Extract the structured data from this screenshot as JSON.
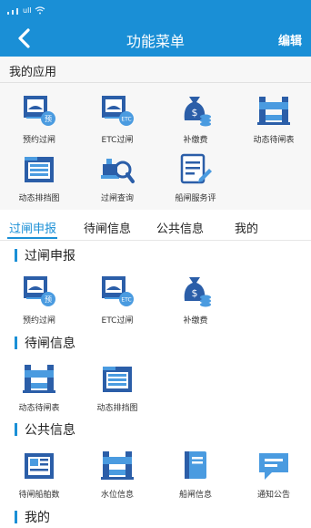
{
  "status": {
    "carrier": "ull",
    "wifi": "wifi-icon"
  },
  "nav": {
    "title": "功能菜单",
    "edit_label": "编辑",
    "back_icon": "chevron-left-icon"
  },
  "my_apps": {
    "heading": "我的应用",
    "items": [
      {
        "label": "预约过闸",
        "icon": "reservation-gate-icon"
      },
      {
        "label": "ETC过闸",
        "icon": "etc-gate-icon"
      },
      {
        "label": "补缴费",
        "icon": "money-bag-icon"
      },
      {
        "label": "动态待闸表",
        "icon": "lock-gate-icon"
      },
      {
        "label": "动态排挡图",
        "icon": "schedule-table-icon"
      },
      {
        "label": "过闸查询",
        "icon": "ship-search-icon"
      },
      {
        "label": "船闸服务评",
        "icon": "review-edit-icon"
      }
    ]
  },
  "tabs": [
    {
      "label": "过闸申报",
      "active": true
    },
    {
      "label": "待闸信息",
      "active": false
    },
    {
      "label": "公共信息",
      "active": false
    },
    {
      "label": "我的",
      "active": false
    }
  ],
  "sections": [
    {
      "title": "过闸申报",
      "items": [
        {
          "label": "预约过闸",
          "icon": "reservation-gate-icon"
        },
        {
          "label": "ETC过闸",
          "icon": "etc-gate-icon"
        },
        {
          "label": "补缴费",
          "icon": "money-bag-icon"
        }
      ]
    },
    {
      "title": "待闸信息",
      "items": [
        {
          "label": "动态待闸表",
          "icon": "lock-gate-icon"
        },
        {
          "label": "动态排挡图",
          "icon": "schedule-table-icon"
        }
      ]
    },
    {
      "title": "公共信息",
      "items": [
        {
          "label": "待闸船舶数",
          "icon": "news-doc-icon"
        },
        {
          "label": "水位信息",
          "icon": "lock-gate-icon"
        },
        {
          "label": "船闸信息",
          "icon": "book-icon"
        },
        {
          "label": "通知公告",
          "icon": "message-bubble-icon"
        }
      ]
    },
    {
      "title": "我的",
      "items": []
    }
  ],
  "colors": {
    "accent": "#1a8fd6",
    "icon_dark": "#2b5ea8",
    "icon_light": "#4a9be0"
  }
}
